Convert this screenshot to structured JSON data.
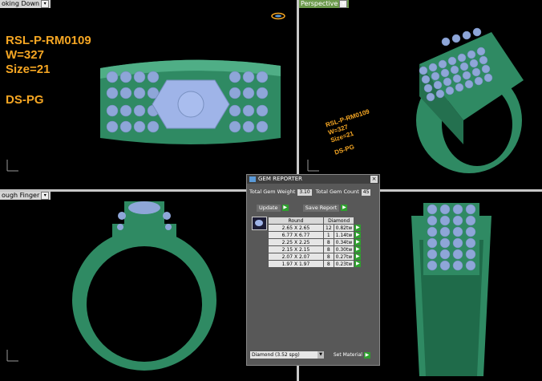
{
  "viewports": {
    "top_left": {
      "label": "oking Down"
    },
    "top_right": {
      "label": "Perspective"
    },
    "bottom_left": {
      "label": "ough Finger"
    },
    "bottom_right": {
      "label": ""
    }
  },
  "model_info": {
    "code": "RSL-P-RM0109",
    "weight": "W=327",
    "size": "Size=21",
    "metal": "DS-PG"
  },
  "gem_reporter": {
    "title": "GEM REPORTER",
    "close": "×",
    "total_weight_label": "Total Gem Weight",
    "total_weight": "3.10",
    "total_count_label": "Total Gem Count",
    "total_count": "45",
    "update_label": "Update",
    "save_report_label": "Save Report",
    "shape_header": "Round",
    "material_header": "Diamond",
    "rows": [
      {
        "size": "2.65 X 2.65",
        "count": "12",
        "tw": "0.82tw"
      },
      {
        "size": "6.77 X 6.77",
        "count": "1",
        "tw": "1.14tw"
      },
      {
        "size": "2.25 X 2.25",
        "count": "8",
        "tw": "0.34tw"
      },
      {
        "size": "2.15 X 2.15",
        "count": "8",
        "tw": "0.30tw"
      },
      {
        "size": "2.07 X 2.07",
        "count": "8",
        "tw": "0.27tw"
      },
      {
        "size": "1.97 X 1.97",
        "count": "8",
        "tw": "0.23tw"
      }
    ],
    "material_select": "Diamond    (3.52 spg)",
    "set_material_label": "Set Material"
  },
  "colors": {
    "metal": "#2f8a63",
    "metal_light": "#4fae86",
    "gem": "#8ea6d8",
    "info_text": "#f5a623",
    "background": "#000000"
  }
}
